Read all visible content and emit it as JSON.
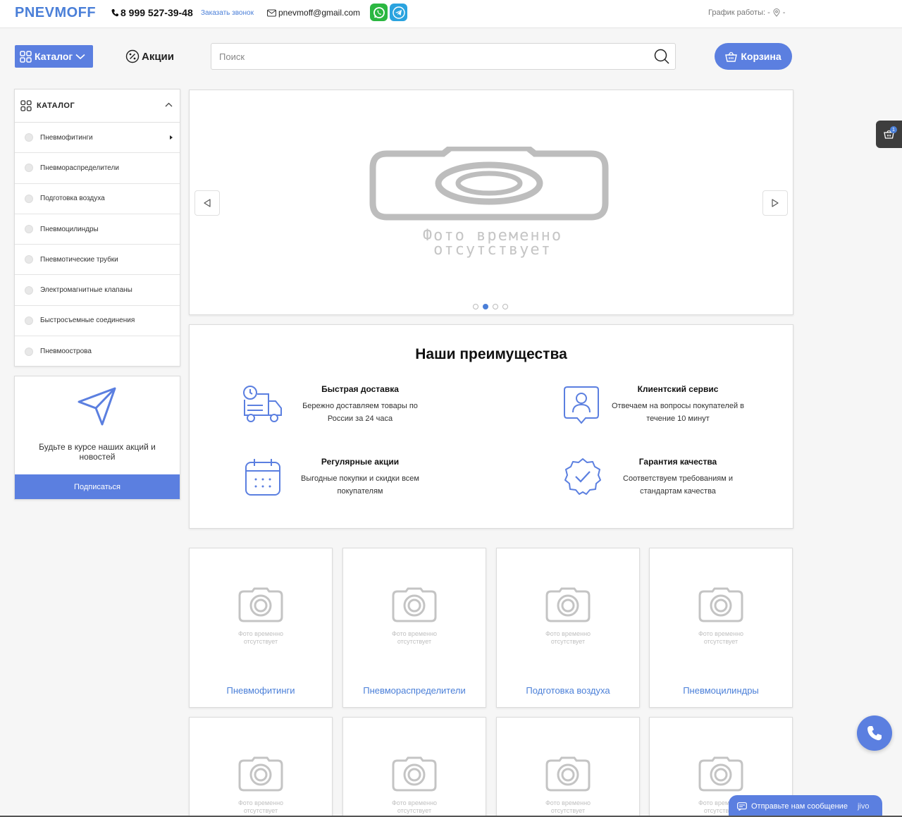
{
  "header": {
    "logo": "PNEVMOFF",
    "phone": "8 999 527-39-48",
    "callback_label": "Заказать звонок",
    "email": "pnevmoff@gmail.com",
    "schedule": "График работы: -",
    "location": "-"
  },
  "toolbar": {
    "catalog_label": "Каталог",
    "promo_label": "Акции",
    "search_placeholder": "Поиск",
    "cart_label": "Корзина"
  },
  "sidebar": {
    "title": "КАТАЛОГ",
    "items": [
      {
        "label": "Пневмофитинги"
      },
      {
        "label": "Пневмораспределители"
      },
      {
        "label": "Подготовка воздуха"
      },
      {
        "label": "Пневмоцилиндры"
      },
      {
        "label": "Пневмотические трубки"
      },
      {
        "label": "Электромагнитные клапаны"
      },
      {
        "label": "Быстросъемные соединения"
      },
      {
        "label": "Пневмоострова"
      }
    ]
  },
  "subscribe": {
    "text": "Будьте в курсе наших акций и новостей",
    "button": "Подписаться"
  },
  "banner": {
    "placeholder_line1": "Фото временно",
    "placeholder_line2": "отсутствует",
    "slides": 4,
    "active_slide": 2
  },
  "advantages": {
    "title": "Наши преимущества",
    "items": [
      {
        "title": "Быстрая доставка",
        "desc": "Бережно доставляем товары по России за 24 часа",
        "icon": "delivery-truck-icon"
      },
      {
        "title": "Клиентский сервис",
        "desc": "Отвечаем на вопросы покупателей в течение 10 минут",
        "icon": "user-badge-icon"
      },
      {
        "title": "Регулярные акции",
        "desc": "Выгодные покупки и скидки всем покупателям",
        "icon": "calendar-icon"
      },
      {
        "title": "Гарантия качества",
        "desc": "Соответствуем требованиям и стандартам качества",
        "icon": "quality-check-icon"
      }
    ]
  },
  "categories": {
    "placeholder_line1": "Фото временно",
    "placeholder_line2": "отсутствует",
    "items": [
      {
        "label": "Пневмофитинги"
      },
      {
        "label": "Пневмораспределители"
      },
      {
        "label": "Подготовка воздуха"
      },
      {
        "label": "Пневмоцилиндры"
      }
    ]
  },
  "widgets": {
    "cart_count": "1",
    "chat_label": "Отправьте нам сообщение",
    "chat_brand": "jivo"
  },
  "colors": {
    "accent": "#5b7fe0",
    "link": "#4a7fd8",
    "whatsapp": "#2bb741",
    "telegram": "#2aa3df"
  }
}
